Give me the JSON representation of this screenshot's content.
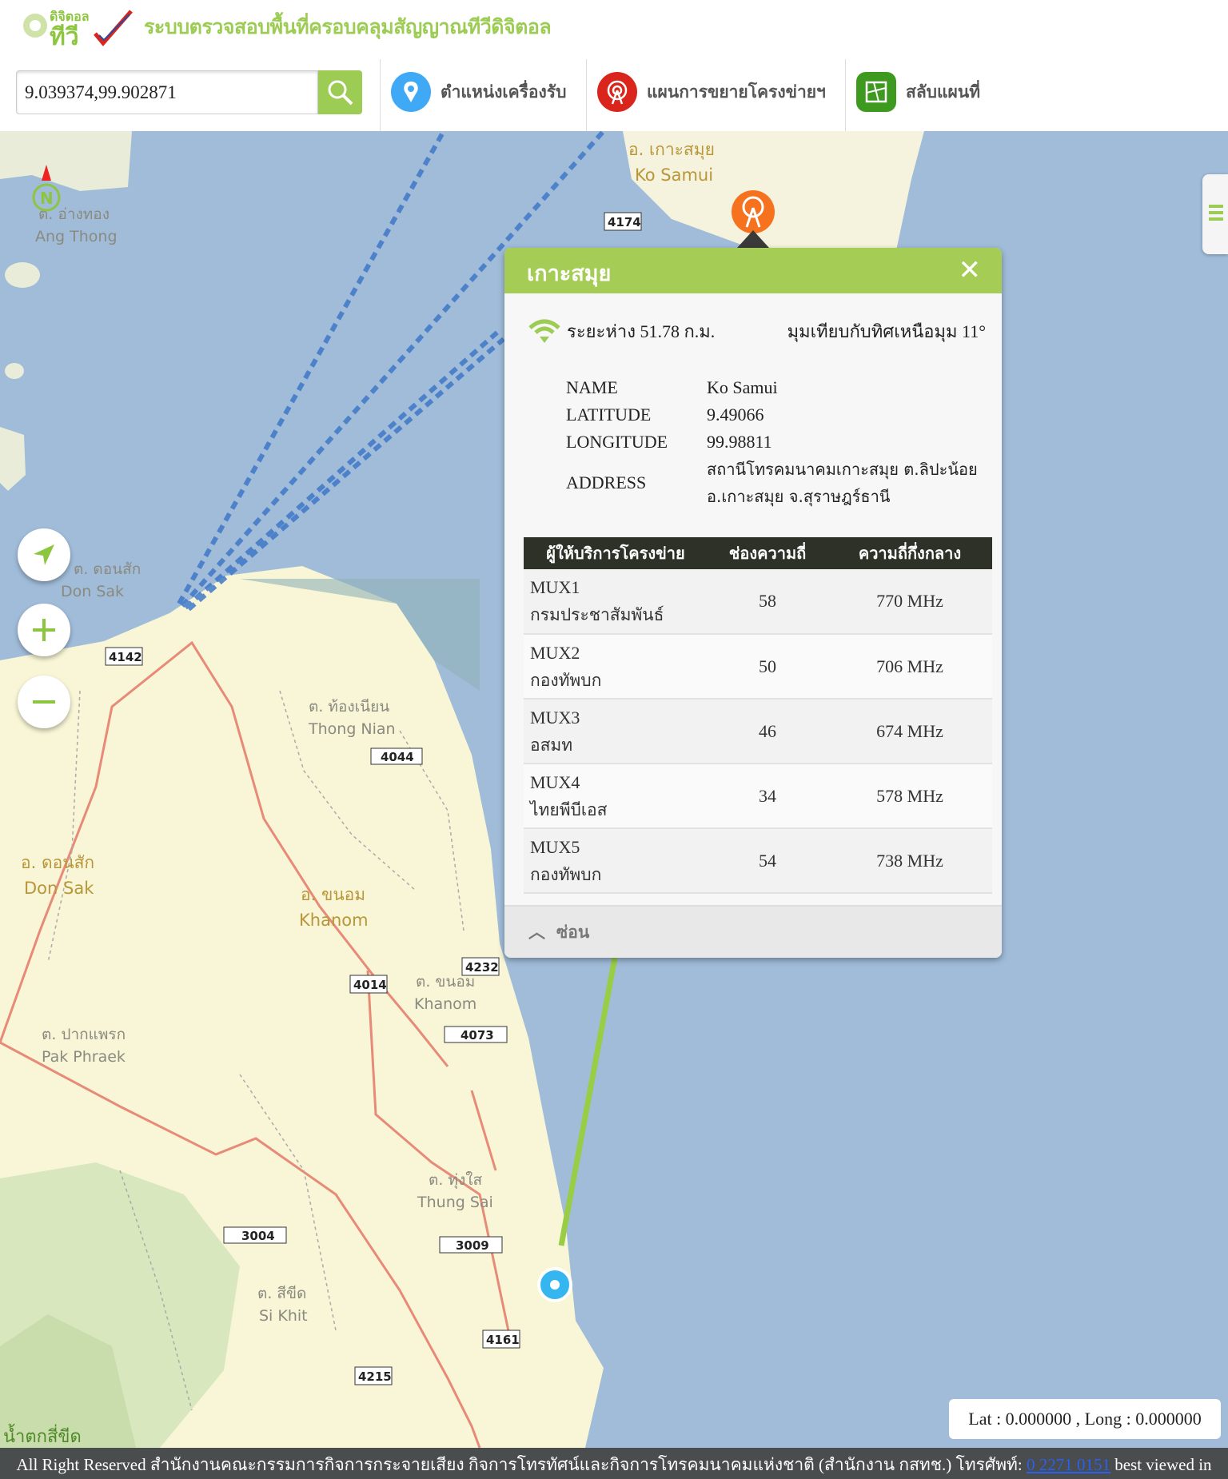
{
  "header": {
    "site_title": "ระบบตรวจสอบพื้นที่ครอบคลุมสัญญาณทีวีดิจิตอล",
    "logo_text": "ดิจิตอล ทีวี",
    "search_value": "9.039374,99.902871",
    "nav": [
      {
        "label": "ตำแหน่งเครื่องรับ",
        "icon": "location-pin-icon",
        "color": "#3fa9f5"
      },
      {
        "label": "แผนการขยายโครงข่ายฯ",
        "icon": "broadcast-tower-icon",
        "color": "#d9251c"
      },
      {
        "label": "สลับแผนที่",
        "icon": "map-switch-icon",
        "color": "#3d9a1e"
      }
    ]
  },
  "map": {
    "labels": {
      "ko_samui_th": "อ. เกาะสมุย",
      "ko_samui": "Ko Samui",
      "ang_thong_th": "ต. อ่างทอง",
      "ang_thong": "Ang Thong",
      "don_sak_th": "อ. ดอนสัก",
      "don_sak": "Don Sak",
      "khanom_th": "อ. ขนอม",
      "khanom": "Khanom",
      "thong_nian_th": "ต. ท้องเนียน",
      "thong_nian": "Thong Nian",
      "khanom2_th": "ต. ขนอม",
      "khanom2": "Khanom",
      "pak_phraek_th": "ต. ปากแพรก",
      "pak_phraek": "Pak Phraek",
      "thung_sai_th": "ต. ทุ่งใส",
      "thung_sai": "Thung Sai",
      "si_khit_th": "ต. สีขีด",
      "si_khit": "Si Khit",
      "don_sak2_th": "ต. ดอนสัก",
      "don_sak2": "Don Sak",
      "nam_tok": "น้ำตกสี่ขีด",
      "compass": "N"
    },
    "roads": [
      "4174",
      "4142",
      "4044",
      "4014",
      "4232",
      "4073",
      "3004",
      "3009",
      "4161",
      "4215"
    ]
  },
  "popup": {
    "title": "เกาะสมุย",
    "distance": "ระยะห่าง 51.78 ก.ม.",
    "bearing": "มุมเทียบกับทิศเหนือมุม 11°",
    "info": [
      {
        "key": "NAME",
        "value": "Ko Samui"
      },
      {
        "key": "LATITUDE",
        "value": "9.49066"
      },
      {
        "key": "LONGITUDE",
        "value": "99.98811"
      },
      {
        "key": "ADDRESS",
        "value": "สถานีโทรคมนาคมเกาะสมุย ต.ลิปะน้อย อ.เกาะสมุย จ.สุราษฎร์ธานี"
      }
    ],
    "table_headers": [
      "ผู้ให้บริการโครงข่าย",
      "ช่องความถี่",
      "ความถี่กึ่งกลาง"
    ],
    "rows": [
      {
        "mux": "MUX1",
        "provider": "กรมประชาสัมพันธ์",
        "channel": "58",
        "freq": "770 MHz"
      },
      {
        "mux": "MUX2",
        "provider": "กองทัพบก",
        "channel": "50",
        "freq": "706 MHz"
      },
      {
        "mux": "MUX3",
        "provider": "อสมท",
        "channel": "46",
        "freq": "674 MHz"
      },
      {
        "mux": "MUX4",
        "provider": "ไทยพีบีเอส",
        "channel": "34",
        "freq": "578 MHz"
      },
      {
        "mux": "MUX5",
        "provider": "กองทัพบก",
        "channel": "54",
        "freq": "738 MHz"
      }
    ],
    "hide_label": "ซ่อน"
  },
  "latlong": "Lat : 0.000000 , Long : 0.000000",
  "footer": {
    "text": "All Right Reserved สำนักงานคณะกรรมการกิจการกระจายเสียง กิจการโทรทัศน์และกิจการโทรคมนาคมแห่งชาติ (สำนักงาน กสทช.) โทรศัพท์: ",
    "phone": "0 2271 0151",
    "suffix": " best viewed in"
  }
}
